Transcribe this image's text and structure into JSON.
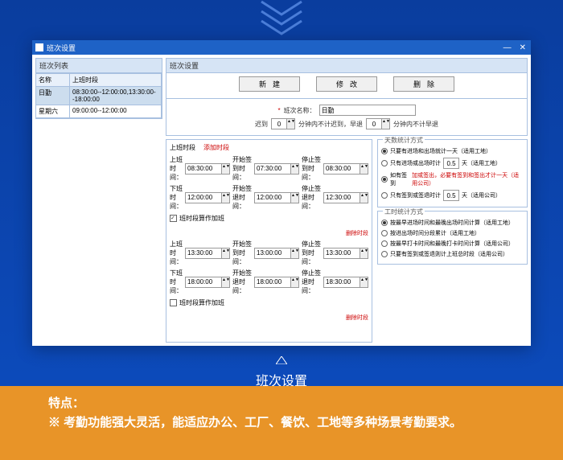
{
  "window": {
    "title": "班次设置"
  },
  "left": {
    "header": "班次列表",
    "cols": [
      "名称",
      "上班时段"
    ],
    "rows": [
      {
        "name": "日勤",
        "span": "08:30:00--12:00:00,13:30:00--18:00:00"
      },
      {
        "name": "星期六",
        "span": "09:00:00--12:00:00"
      }
    ]
  },
  "right": {
    "header": "班次设置",
    "btn_new": "新建",
    "btn_edit": "修改",
    "btn_del": "删除",
    "lbl_name": "班次名称：",
    "name_val": "日勤",
    "lbl_late": "迟到",
    "late_val": "0",
    "lbl_late_unit": "分钟内不计迟到，早退",
    "early_val": "0",
    "lbl_early_unit": "分钟内不计早退"
  },
  "shift": {
    "header": "上班时段",
    "add": "添加时段",
    "rows1": [
      {
        "lbl": "上班时间：",
        "v": "08:30:00",
        "l2": "开始签到时间：",
        "v2": "07:30:00",
        "l3": "停止签到时间：",
        "v3": "08:30:00"
      },
      {
        "lbl": "下班时间：",
        "v": "12:00:00",
        "l2": "开始签退时间：",
        "v2": "12:00:00",
        "l3": "停止签退时间：",
        "v3": "12:30:00"
      }
    ],
    "chk1": "班时段算作加班",
    "del1": "删除时段",
    "rows2": [
      {
        "lbl": "上班时间：",
        "v": "13:30:00",
        "l2": "开始签到时间：",
        "v2": "13:00:00",
        "l3": "停止签到时间：",
        "v3": "13:30:00"
      },
      {
        "lbl": "下班时间：",
        "v": "18:00:00",
        "l2": "开始签退时间：",
        "v2": "18:00:00",
        "l3": "停止签退时间：",
        "v3": "18:30:00"
      }
    ],
    "chk2": "班时段算作加班",
    "del2": "删除时段"
  },
  "days": {
    "legend": "天数统计方式",
    "r1": "只要有进场和出场就计一天（适用工地）",
    "r2a": "只有进场或出场时计",
    "r2v": "0.5",
    "r2b": "天（适用工地）",
    "r3a": "如有签到",
    "r3b": "加或签出，必要有签到和签出才计一天（适用公司）",
    "r4a": "只有签到或签退时计",
    "r4v": "0.5",
    "r4b": "天（适用公司）"
  },
  "hours": {
    "legend": "工时统计方式",
    "r1": "按最早进场时间和最晚出场时间计算（适用工地）",
    "r2": "按进出场时间分段累计（适用工地）",
    "r3": "按最早打卡时间和最晚打卡时间计算（适用公司）",
    "r4": "只要有签到或签退则计上班总时段（适用公司）"
  },
  "caption": "班次设置",
  "footer": {
    "title": "特点：",
    "text": "※ 考勤功能强大灵活，能适应办公、工厂、餐饮、工地等多种场景考勤要求。"
  }
}
